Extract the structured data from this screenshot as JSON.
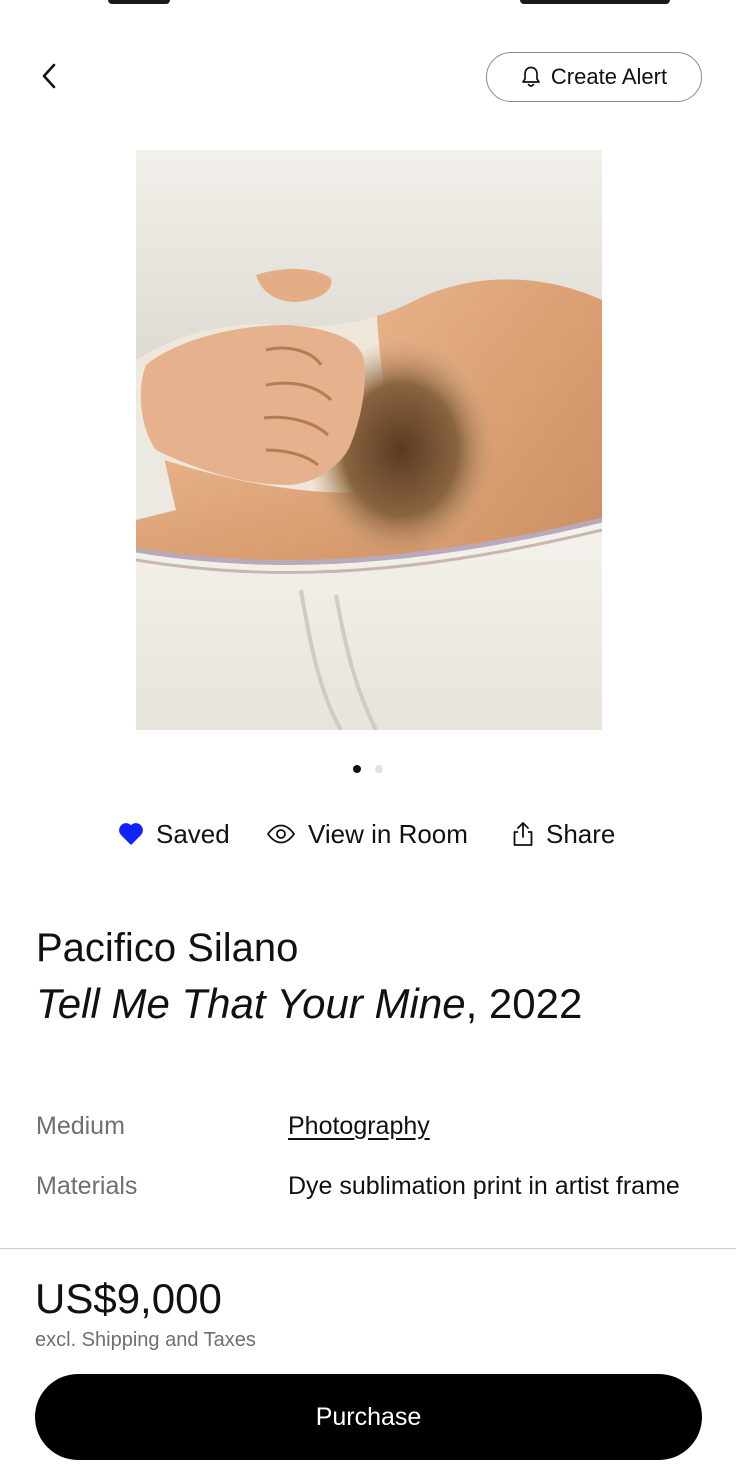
{
  "header": {
    "create_alert_label": "Create Alert"
  },
  "carousel": {
    "total": 2,
    "active_index": 0
  },
  "actions": {
    "saved_label": "Saved",
    "view_in_room_label": "View in Room",
    "share_label": "Share",
    "saved_heart_color": "#1023ff"
  },
  "artwork": {
    "artist": "Pacifico Silano",
    "title": "Tell Me That Your Mine",
    "year_suffix": ", 2022"
  },
  "details": {
    "medium_label": "Medium",
    "medium_value": "Photography",
    "materials_label": "Materials",
    "materials_value": "Dye sublimation print in artist frame"
  },
  "purchase": {
    "price": "US$9,000",
    "price_note": "excl. Shipping and Taxes",
    "button_label": "Purchase"
  }
}
